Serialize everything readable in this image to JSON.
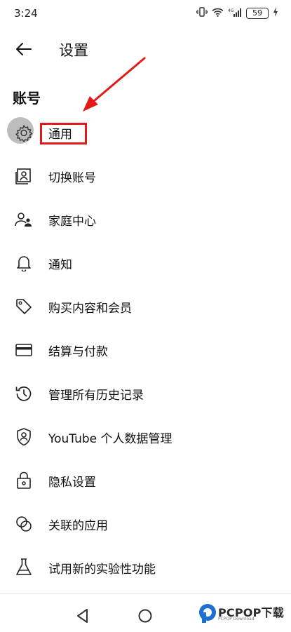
{
  "status": {
    "time": "3:24",
    "battery": "59"
  },
  "header": {
    "title": "设置"
  },
  "section": {
    "title": "账号"
  },
  "menu": [
    {
      "label": "通用",
      "icon": "gear-icon"
    },
    {
      "label": "切换账号",
      "icon": "switch-account-icon"
    },
    {
      "label": "家庭中心",
      "icon": "family-icon"
    },
    {
      "label": "通知",
      "icon": "bell-icon"
    },
    {
      "label": "购买内容和会员",
      "icon": "tag-icon"
    },
    {
      "label": "结算与付款",
      "icon": "credit-card-icon"
    },
    {
      "label": "管理所有历史记录",
      "icon": "history-icon"
    },
    {
      "label": "YouTube 个人数据管理",
      "icon": "shield-person-icon"
    },
    {
      "label": "隐私设置",
      "icon": "lock-icon"
    },
    {
      "label": "关联的应用",
      "icon": "linked-apps-icon"
    },
    {
      "label": "试用新的实验性功能",
      "icon": "flask-icon"
    }
  ],
  "watermark": {
    "brand": "PCPOP下载",
    "sub": "PCPOP Download"
  },
  "colors": {
    "highlight": "#e11b1b",
    "text": "#0f0f0f"
  }
}
